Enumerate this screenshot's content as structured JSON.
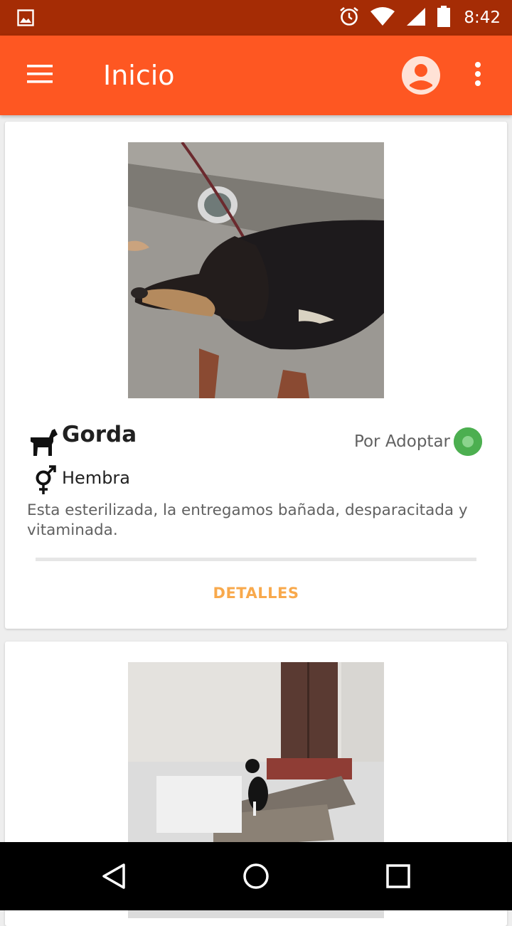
{
  "status_bar": {
    "time": "8:42",
    "icons": [
      "image-notification-icon",
      "alarm-icon",
      "wifi-icon",
      "cell-signal-icon",
      "battery-icon"
    ]
  },
  "app_bar": {
    "title": "Inicio",
    "icons": [
      "menu-icon",
      "account-icon",
      "more-vert-icon"
    ]
  },
  "pets": [
    {
      "name": "Gorda",
      "status": "Por Adoptar",
      "status_color": "#4caf50",
      "sex": "Hembra",
      "description": "Esta esterilizada, la entregamos bañada, desparacitada y vitaminada.",
      "details_label": "DETALLES"
    }
  ],
  "colors": {
    "status_bar": "#a52c05",
    "app_bar": "#fe5722",
    "accent": "#f8a94c",
    "available": "#4caf50"
  },
  "nav_bar": {
    "icons": [
      "back-icon",
      "home-icon",
      "recents-icon"
    ]
  }
}
